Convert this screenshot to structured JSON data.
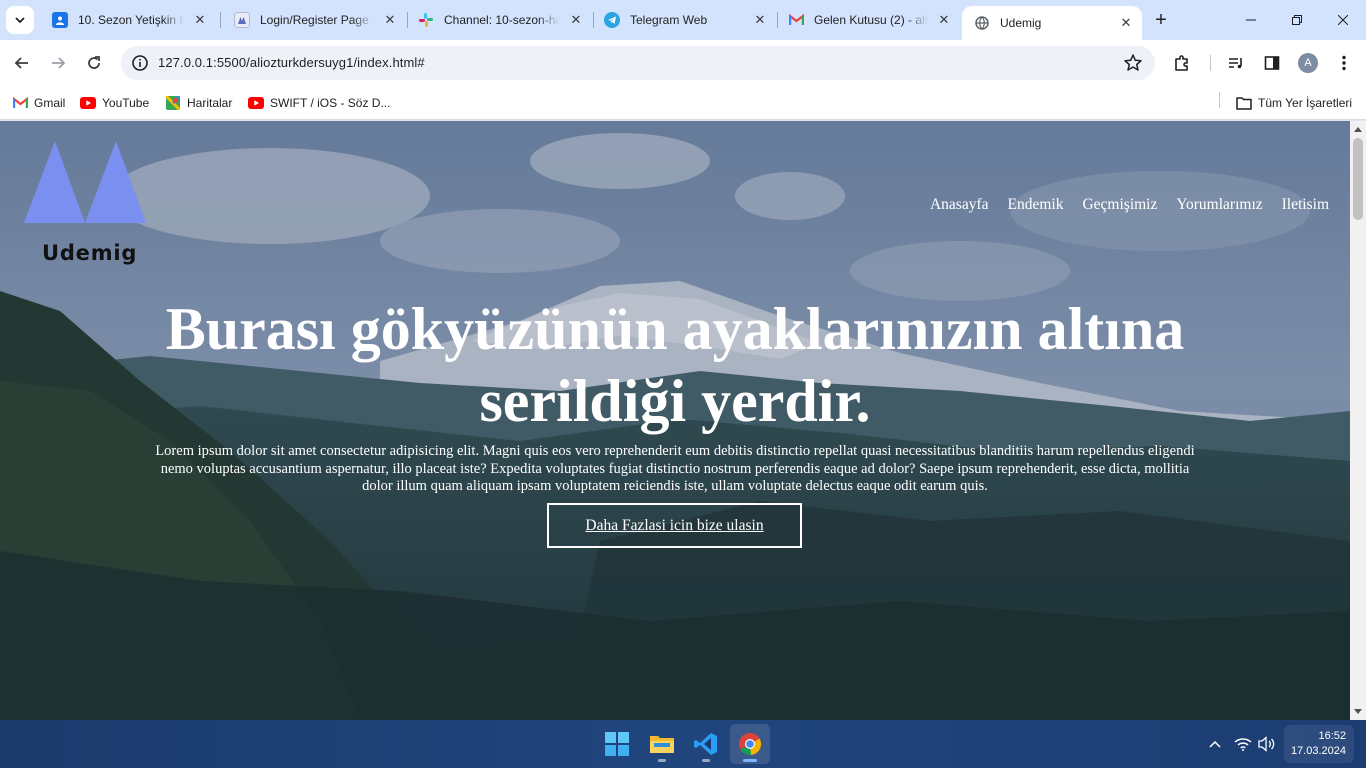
{
  "browser": {
    "tabs": [
      {
        "title": "10. Sezon Yetişkin Ha",
        "icon": "classroom-icon",
        "active": false
      },
      {
        "title": "Login/Register Page |",
        "icon": "page-icon",
        "active": false
      },
      {
        "title": "Channel: 10-sezon-ha",
        "icon": "slack-icon",
        "active": false
      },
      {
        "title": "Telegram Web",
        "icon": "telegram-icon",
        "active": false
      },
      {
        "title": "Gelen Kutusu (2) - ali",
        "icon": "gmail-icon",
        "active": false
      },
      {
        "title": "Udemig",
        "icon": "globe-icon",
        "active": true
      }
    ],
    "new_tab_label": "+",
    "address_bar": {
      "url": "127.0.0.1:5500/aliozturkdersuyg1/index.html#"
    },
    "profile_initial": "A",
    "bookmarks": [
      {
        "label": "Gmail",
        "icon": "gmail-icon"
      },
      {
        "label": "YouTube",
        "icon": "youtube-icon"
      },
      {
        "label": "Haritalar",
        "icon": "maps-icon"
      },
      {
        "label": "SWIFT / iOS - Söz D...",
        "icon": "youtube-icon"
      }
    ],
    "all_bookmarks_label": "Tüm Yer İşaretleri"
  },
  "site": {
    "brand": "Udemig",
    "nav": [
      "Anasayfa",
      "Endemik",
      "Geçmişimiz",
      "Yorumlarımız",
      "Iletisim"
    ],
    "hero": {
      "title": "Burası gökyüzünün ayaklarınızın altına serildiği yerdir.",
      "text": "Lorem ipsum dolor sit amet consectetur adipisicing elit. Magni quis eos vero reprehenderit eum debitis distinctio repellat quasi necessitatibus blanditiis harum repellendus eligendi nemo voluptas accusantium aspernatur, illo placeat iste? Expedita voluptates fugiat distinctio nostrum perferendis eaque ad dolor? Saepe ipsum reprehenderit, esse dicta, mollitia dolor illum quam aliquam ipsam voluptatem reiciendis iste, ullam voluptate delectus eaque odit earum quis.",
      "button": "Daha Fazlasi icin bize ulasin"
    },
    "colors": {
      "logo": "#7b8ff0",
      "brand_text": "#111111",
      "text": "#ffffff"
    }
  },
  "taskbar": {
    "apps": [
      {
        "name": "start",
        "icon": "windows-icon"
      },
      {
        "name": "file-explorer",
        "icon": "folder-icon"
      },
      {
        "name": "vscode",
        "icon": "vscode-icon"
      },
      {
        "name": "chrome",
        "icon": "chrome-icon"
      }
    ],
    "time": "16:52",
    "date": "17.03.2024"
  }
}
